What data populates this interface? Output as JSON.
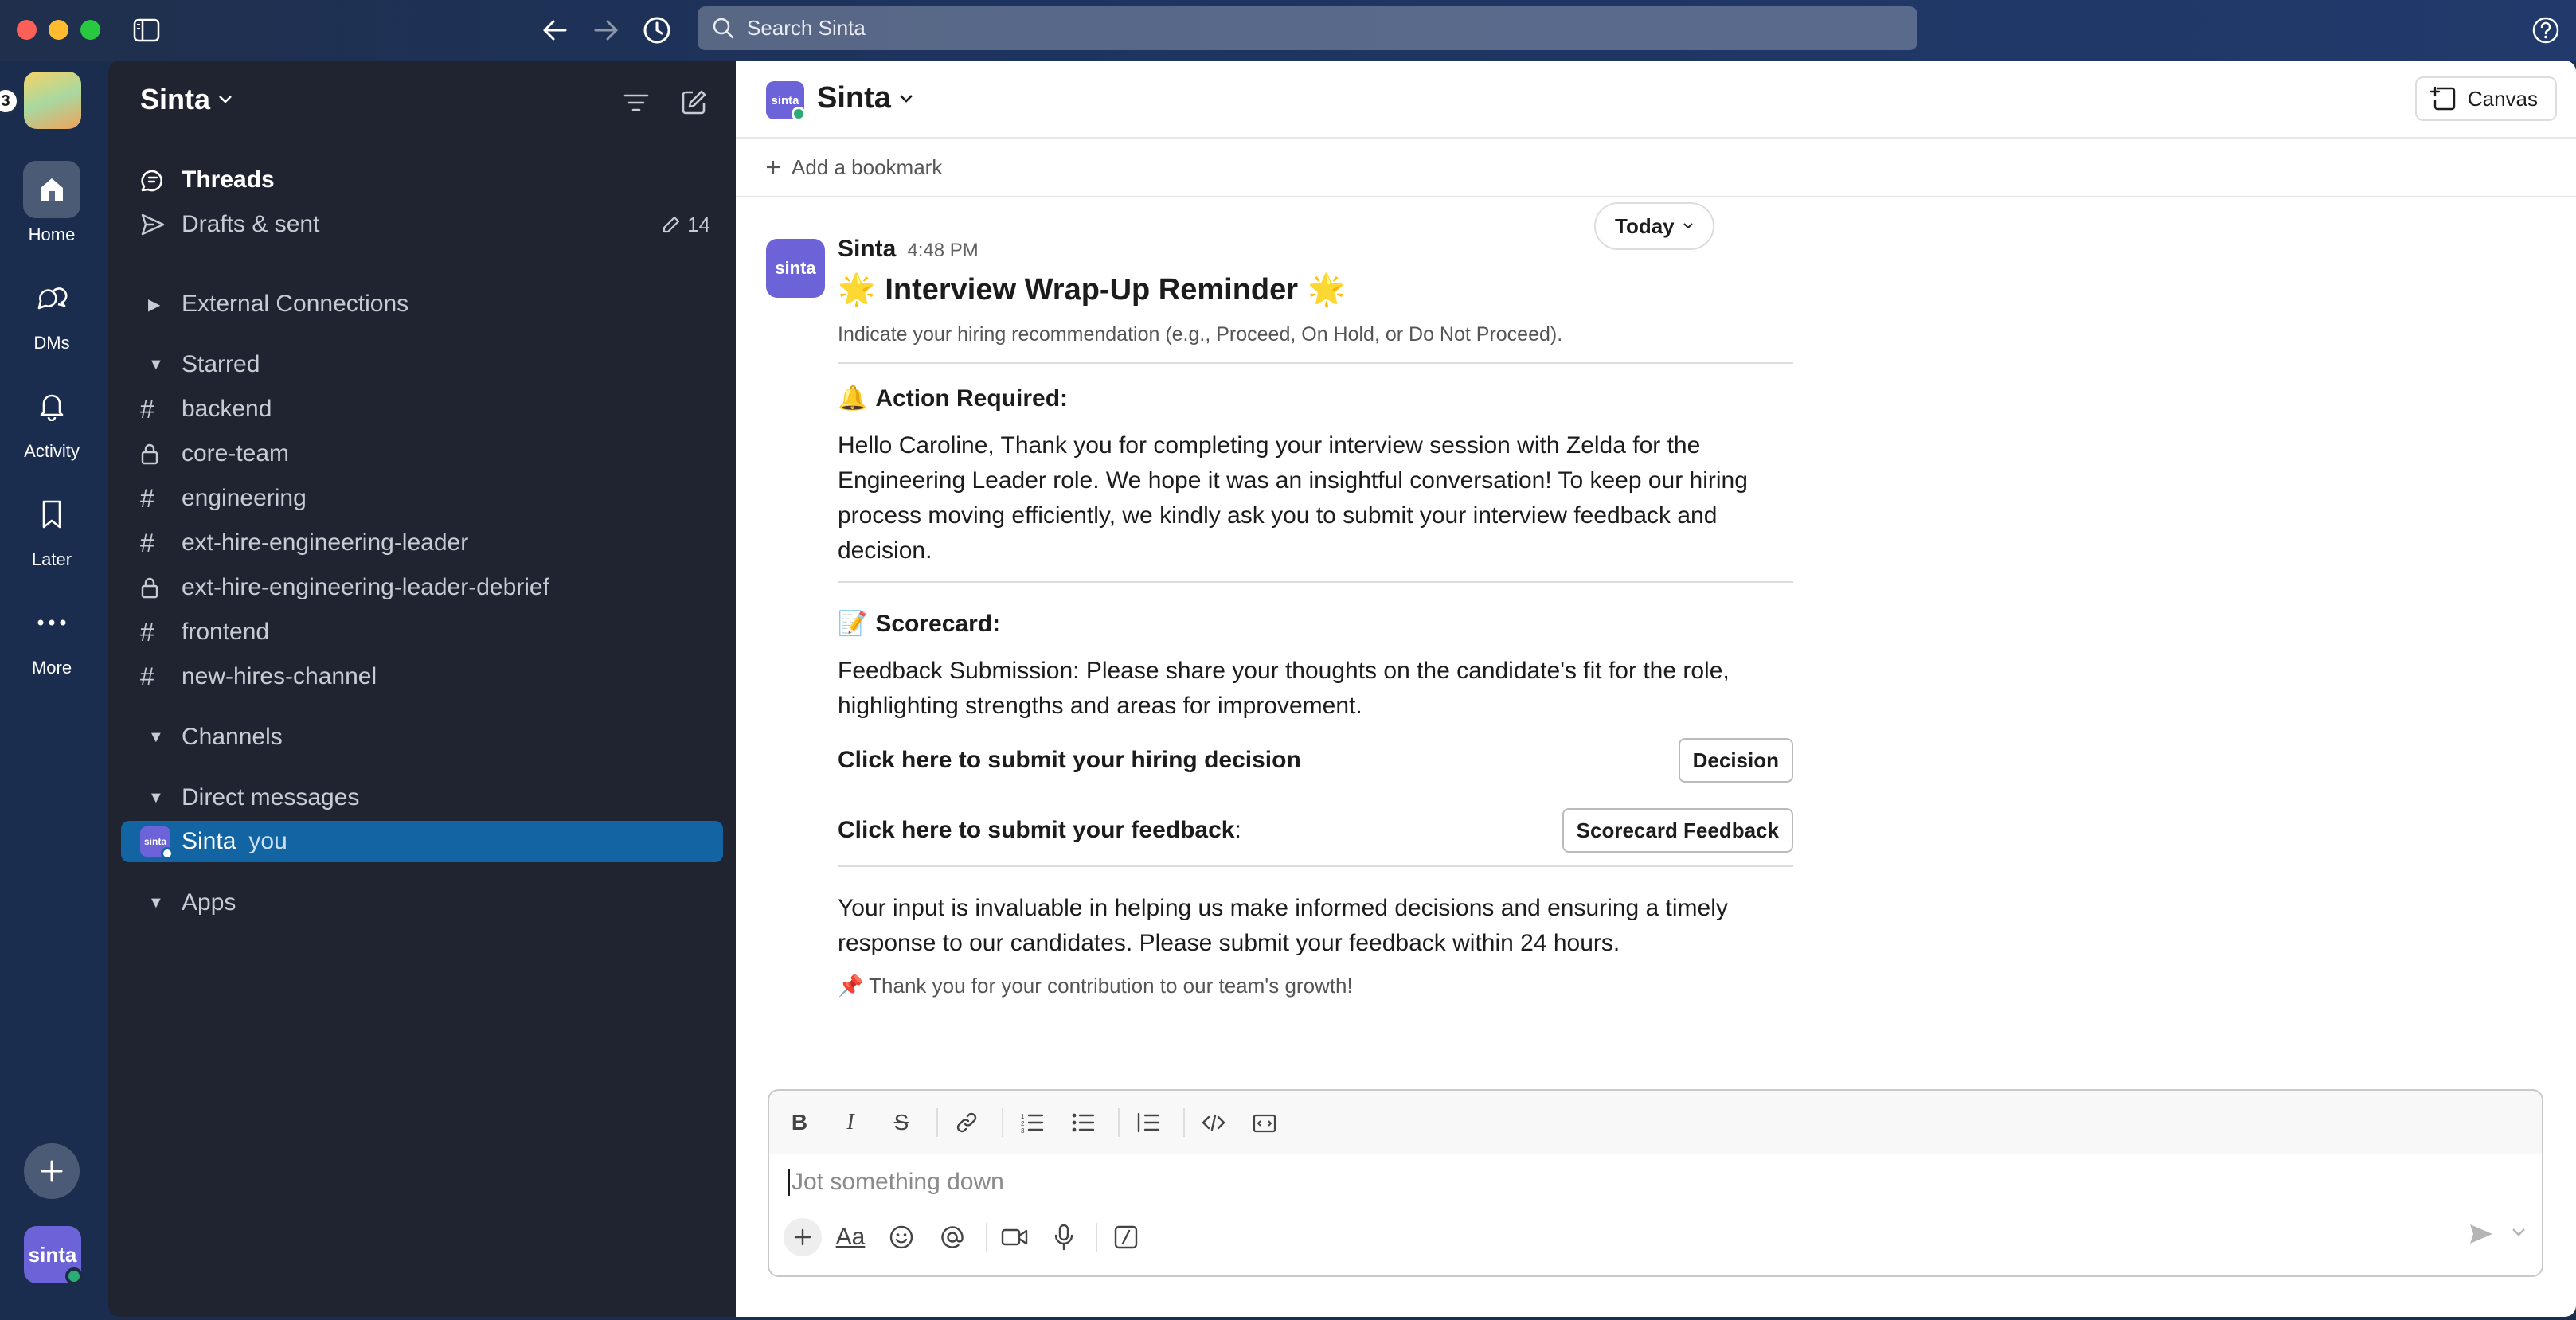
{
  "search": {
    "placeholder": "Search Sinta"
  },
  "rail": {
    "badge": "3",
    "items": [
      {
        "label": "Home",
        "icon": "home-icon"
      },
      {
        "label": "DMs",
        "icon": "dms-icon"
      },
      {
        "label": "Activity",
        "icon": "bell-icon"
      },
      {
        "label": "Later",
        "icon": "bookmark-icon"
      },
      {
        "label": "More",
        "icon": "more-icon"
      }
    ],
    "avatar_text": "sinta"
  },
  "sidebar": {
    "workspace": "Sinta",
    "threads": "Threads",
    "drafts": "Drafts & sent",
    "drafts_count": "14",
    "external": "External Connections",
    "starred": "Starred",
    "channels_starred": [
      {
        "name": "backend",
        "type": "public"
      },
      {
        "name": "core-team",
        "type": "private"
      },
      {
        "name": "engineering",
        "type": "public"
      },
      {
        "name": "ext-hire-engineering-leader",
        "type": "public"
      },
      {
        "name": "ext-hire-engineering-leader-debrief",
        "type": "private"
      },
      {
        "name": "frontend",
        "type": "public"
      },
      {
        "name": "new-hires-channel",
        "type": "public"
      }
    ],
    "channels": "Channels",
    "dms": "Direct messages",
    "dm_name": "Sinta",
    "dm_you": "you",
    "apps": "Apps"
  },
  "channel": {
    "name": "Sinta",
    "logo_text": "sinta",
    "canvas_label": "Canvas",
    "bookmark_label": "Add a bookmark",
    "today_label": "Today"
  },
  "message": {
    "sender": "Sinta",
    "time": "4:48 PM",
    "avatar_text": "sinta",
    "title": "Interview Wrap-Up Reminder",
    "title_emoji": "🌟",
    "subtitle": "Indicate your hiring recommendation (e.g., Proceed, On Hold, or Do Not Proceed).",
    "action_emoji": "🔔",
    "action_heading": "Action Required:",
    "action_body": "Hello Caroline, Thank you for completing your interview session with Zelda for the Engineering Leader role. We hope it was an insightful conversation! To keep our hiring process moving efficiently, we kindly ask you to submit your interview feedback and decision.",
    "scorecard_emoji": "📝",
    "scorecard_heading": "Scorecard:",
    "scorecard_body": "Feedback Submission: Please share your thoughts on the candidate's fit for the role, highlighting strengths and areas for improvement.",
    "decision_label": "Click here to submit your hiring decision",
    "decision_button": "Decision",
    "feedback_label": "Click here to submit your feedback",
    "feedback_colon": ":",
    "feedback_button": "Scorecard Feedback",
    "closing_body": "Your input is invaluable in helping us make informed decisions and ensuring a timely response to our candidates. Please submit your feedback within 24 hours.",
    "footer_emoji": "📌",
    "footer": "Thank you for your contribution to our team's growth!"
  },
  "composer": {
    "placeholder": "Jot something down"
  }
}
